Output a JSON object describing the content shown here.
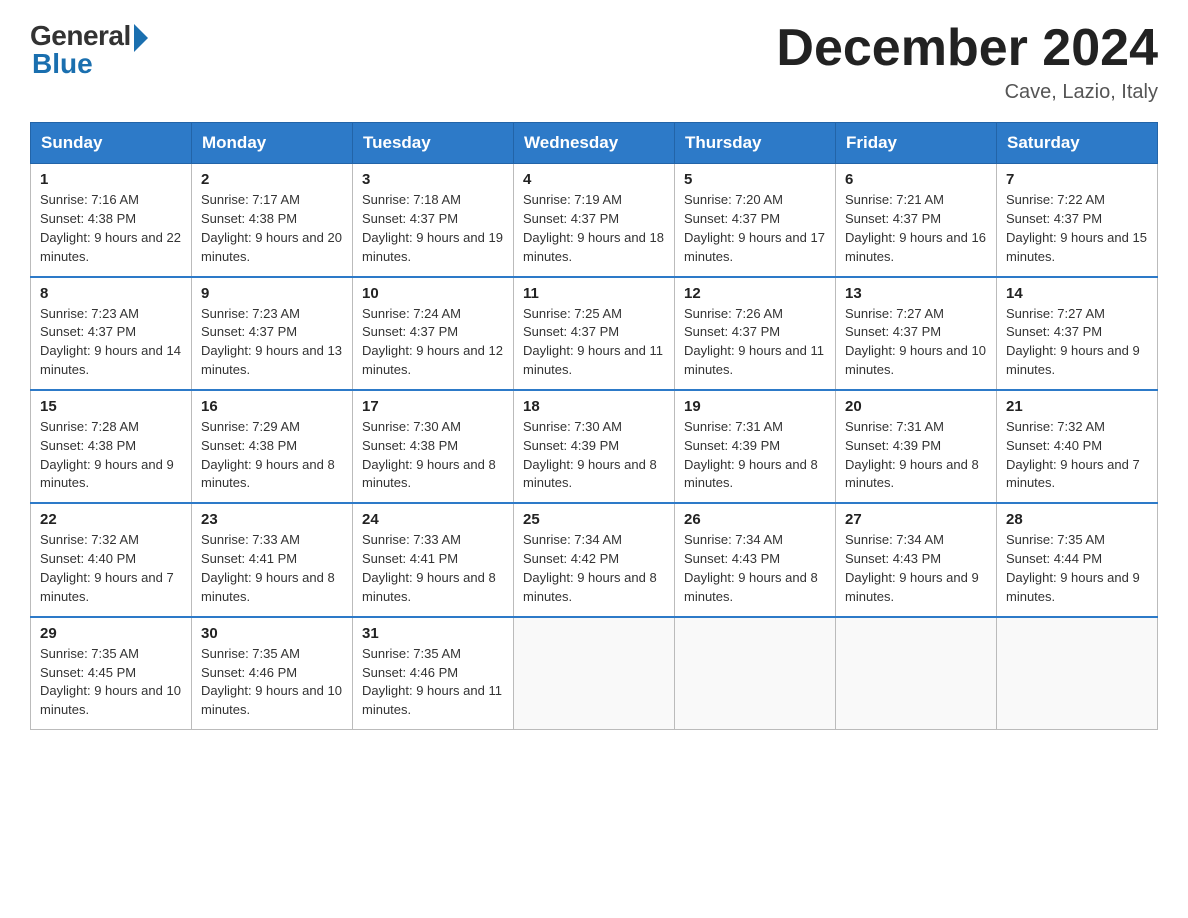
{
  "header": {
    "logo_general": "General",
    "logo_blue": "Blue",
    "month_title": "December 2024",
    "location": "Cave, Lazio, Italy"
  },
  "weekdays": [
    "Sunday",
    "Monday",
    "Tuesday",
    "Wednesday",
    "Thursday",
    "Friday",
    "Saturday"
  ],
  "weeks": [
    [
      {
        "day": "1",
        "sunrise": "7:16 AM",
        "sunset": "4:38 PM",
        "daylight": "9 hours and 22 minutes."
      },
      {
        "day": "2",
        "sunrise": "7:17 AM",
        "sunset": "4:38 PM",
        "daylight": "9 hours and 20 minutes."
      },
      {
        "day": "3",
        "sunrise": "7:18 AM",
        "sunset": "4:37 PM",
        "daylight": "9 hours and 19 minutes."
      },
      {
        "day": "4",
        "sunrise": "7:19 AM",
        "sunset": "4:37 PM",
        "daylight": "9 hours and 18 minutes."
      },
      {
        "day": "5",
        "sunrise": "7:20 AM",
        "sunset": "4:37 PM",
        "daylight": "9 hours and 17 minutes."
      },
      {
        "day": "6",
        "sunrise": "7:21 AM",
        "sunset": "4:37 PM",
        "daylight": "9 hours and 16 minutes."
      },
      {
        "day": "7",
        "sunrise": "7:22 AM",
        "sunset": "4:37 PM",
        "daylight": "9 hours and 15 minutes."
      }
    ],
    [
      {
        "day": "8",
        "sunrise": "7:23 AM",
        "sunset": "4:37 PM",
        "daylight": "9 hours and 14 minutes."
      },
      {
        "day": "9",
        "sunrise": "7:23 AM",
        "sunset": "4:37 PM",
        "daylight": "9 hours and 13 minutes."
      },
      {
        "day": "10",
        "sunrise": "7:24 AM",
        "sunset": "4:37 PM",
        "daylight": "9 hours and 12 minutes."
      },
      {
        "day": "11",
        "sunrise": "7:25 AM",
        "sunset": "4:37 PM",
        "daylight": "9 hours and 11 minutes."
      },
      {
        "day": "12",
        "sunrise": "7:26 AM",
        "sunset": "4:37 PM",
        "daylight": "9 hours and 11 minutes."
      },
      {
        "day": "13",
        "sunrise": "7:27 AM",
        "sunset": "4:37 PM",
        "daylight": "9 hours and 10 minutes."
      },
      {
        "day": "14",
        "sunrise": "7:27 AM",
        "sunset": "4:37 PM",
        "daylight": "9 hours and 9 minutes."
      }
    ],
    [
      {
        "day": "15",
        "sunrise": "7:28 AM",
        "sunset": "4:38 PM",
        "daylight": "9 hours and 9 minutes."
      },
      {
        "day": "16",
        "sunrise": "7:29 AM",
        "sunset": "4:38 PM",
        "daylight": "9 hours and 8 minutes."
      },
      {
        "day": "17",
        "sunrise": "7:30 AM",
        "sunset": "4:38 PM",
        "daylight": "9 hours and 8 minutes."
      },
      {
        "day": "18",
        "sunrise": "7:30 AM",
        "sunset": "4:39 PM",
        "daylight": "9 hours and 8 minutes."
      },
      {
        "day": "19",
        "sunrise": "7:31 AM",
        "sunset": "4:39 PM",
        "daylight": "9 hours and 8 minutes."
      },
      {
        "day": "20",
        "sunrise": "7:31 AM",
        "sunset": "4:39 PM",
        "daylight": "9 hours and 8 minutes."
      },
      {
        "day": "21",
        "sunrise": "7:32 AM",
        "sunset": "4:40 PM",
        "daylight": "9 hours and 7 minutes."
      }
    ],
    [
      {
        "day": "22",
        "sunrise": "7:32 AM",
        "sunset": "4:40 PM",
        "daylight": "9 hours and 7 minutes."
      },
      {
        "day": "23",
        "sunrise": "7:33 AM",
        "sunset": "4:41 PM",
        "daylight": "9 hours and 8 minutes."
      },
      {
        "day": "24",
        "sunrise": "7:33 AM",
        "sunset": "4:41 PM",
        "daylight": "9 hours and 8 minutes."
      },
      {
        "day": "25",
        "sunrise": "7:34 AM",
        "sunset": "4:42 PM",
        "daylight": "9 hours and 8 minutes."
      },
      {
        "day": "26",
        "sunrise": "7:34 AM",
        "sunset": "4:43 PM",
        "daylight": "9 hours and 8 minutes."
      },
      {
        "day": "27",
        "sunrise": "7:34 AM",
        "sunset": "4:43 PM",
        "daylight": "9 hours and 9 minutes."
      },
      {
        "day": "28",
        "sunrise": "7:35 AM",
        "sunset": "4:44 PM",
        "daylight": "9 hours and 9 minutes."
      }
    ],
    [
      {
        "day": "29",
        "sunrise": "7:35 AM",
        "sunset": "4:45 PM",
        "daylight": "9 hours and 10 minutes."
      },
      {
        "day": "30",
        "sunrise": "7:35 AM",
        "sunset": "4:46 PM",
        "daylight": "9 hours and 10 minutes."
      },
      {
        "day": "31",
        "sunrise": "7:35 AM",
        "sunset": "4:46 PM",
        "daylight": "9 hours and 11 minutes."
      },
      null,
      null,
      null,
      null
    ]
  ]
}
